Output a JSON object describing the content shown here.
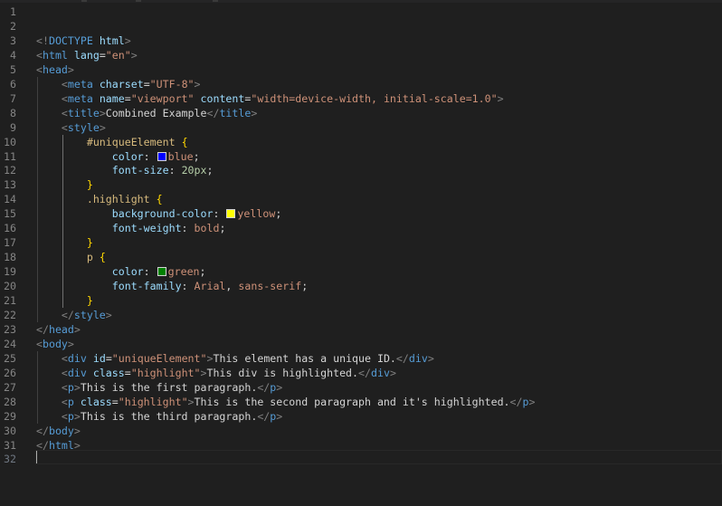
{
  "editor": {
    "lines": [
      {
        "n": "1",
        "tokens": []
      },
      {
        "n": "2",
        "tokens": []
      },
      {
        "n": "3",
        "tokens": [
          {
            "c": "br",
            "t": "<!"
          },
          {
            "c": "tag",
            "t": "DOCTYPE"
          },
          {
            "c": "txt",
            "t": " "
          },
          {
            "c": "attr",
            "t": "html"
          },
          {
            "c": "br",
            "t": ">"
          }
        ]
      },
      {
        "n": "4",
        "tokens": [
          {
            "c": "br",
            "t": "<"
          },
          {
            "c": "tag",
            "t": "html"
          },
          {
            "c": "txt",
            "t": " "
          },
          {
            "c": "attr",
            "t": "lang"
          },
          {
            "c": "txt",
            "t": "="
          },
          {
            "c": "str",
            "t": "\"en\""
          },
          {
            "c": "br",
            "t": ">"
          }
        ]
      },
      {
        "n": "5",
        "tokens": [
          {
            "c": "br",
            "t": "<"
          },
          {
            "c": "tag",
            "t": "head"
          },
          {
            "c": "br",
            "t": ">"
          }
        ]
      },
      {
        "n": "6",
        "tokens": [
          {
            "c": "txt",
            "t": "    "
          },
          {
            "c": "br",
            "t": "<"
          },
          {
            "c": "tag",
            "t": "meta"
          },
          {
            "c": "txt",
            "t": " "
          },
          {
            "c": "attr",
            "t": "charset"
          },
          {
            "c": "txt",
            "t": "="
          },
          {
            "c": "str",
            "t": "\"UTF-8\""
          },
          {
            "c": "br",
            "t": ">"
          }
        ]
      },
      {
        "n": "7",
        "tokens": [
          {
            "c": "txt",
            "t": "    "
          },
          {
            "c": "br",
            "t": "<"
          },
          {
            "c": "tag",
            "t": "meta"
          },
          {
            "c": "txt",
            "t": " "
          },
          {
            "c": "attr",
            "t": "name"
          },
          {
            "c": "txt",
            "t": "="
          },
          {
            "c": "str",
            "t": "\"viewport\""
          },
          {
            "c": "txt",
            "t": " "
          },
          {
            "c": "attr",
            "t": "content"
          },
          {
            "c": "txt",
            "t": "="
          },
          {
            "c": "str",
            "t": "\"width=device-width, initial-scale=1.0\""
          },
          {
            "c": "br",
            "t": ">"
          }
        ]
      },
      {
        "n": "8",
        "tokens": [
          {
            "c": "txt",
            "t": "    "
          },
          {
            "c": "br",
            "t": "<"
          },
          {
            "c": "tag",
            "t": "title"
          },
          {
            "c": "br",
            "t": ">"
          },
          {
            "c": "txt",
            "t": "Combined Example"
          },
          {
            "c": "br",
            "t": "</"
          },
          {
            "c": "tag",
            "t": "title"
          },
          {
            "c": "br",
            "t": ">"
          }
        ]
      },
      {
        "n": "9",
        "tokens": [
          {
            "c": "txt",
            "t": "    "
          },
          {
            "c": "br",
            "t": "<"
          },
          {
            "c": "tag",
            "t": "style"
          },
          {
            "c": "br",
            "t": ">"
          }
        ]
      },
      {
        "n": "10",
        "tokens": [
          {
            "c": "txt",
            "t": "        "
          },
          {
            "c": "sel",
            "t": "#uniqueElement"
          },
          {
            "c": "txt",
            "t": " "
          },
          {
            "c": "brace",
            "t": "{"
          }
        ]
      },
      {
        "n": "11",
        "tokens": [
          {
            "c": "txt",
            "t": "            "
          },
          {
            "c": "prop",
            "t": "color"
          },
          {
            "c": "txt",
            "t": ": "
          },
          {
            "c": "swatch",
            "t": "#0000ff"
          },
          {
            "c": "val",
            "t": "blue"
          },
          {
            "c": "txt",
            "t": ";"
          }
        ]
      },
      {
        "n": "12",
        "tokens": [
          {
            "c": "txt",
            "t": "            "
          },
          {
            "c": "prop",
            "t": "font-size"
          },
          {
            "c": "txt",
            "t": ": "
          },
          {
            "c": "num",
            "t": "20px"
          },
          {
            "c": "txt",
            "t": ";"
          }
        ]
      },
      {
        "n": "13",
        "tokens": [
          {
            "c": "txt",
            "t": "        "
          },
          {
            "c": "brace",
            "t": "}"
          }
        ]
      },
      {
        "n": "14",
        "tokens": [
          {
            "c": "txt",
            "t": "        "
          },
          {
            "c": "sel",
            "t": ".highlight"
          },
          {
            "c": "txt",
            "t": " "
          },
          {
            "c": "brace",
            "t": "{"
          }
        ]
      },
      {
        "n": "15",
        "tokens": [
          {
            "c": "txt",
            "t": "            "
          },
          {
            "c": "prop",
            "t": "background-color"
          },
          {
            "c": "txt",
            "t": ": "
          },
          {
            "c": "swatch",
            "t": "#ffff00"
          },
          {
            "c": "val",
            "t": "yellow"
          },
          {
            "c": "txt",
            "t": ";"
          }
        ]
      },
      {
        "n": "16",
        "tokens": [
          {
            "c": "txt",
            "t": "            "
          },
          {
            "c": "prop",
            "t": "font-weight"
          },
          {
            "c": "txt",
            "t": ": "
          },
          {
            "c": "val",
            "t": "bold"
          },
          {
            "c": "txt",
            "t": ";"
          }
        ]
      },
      {
        "n": "17",
        "tokens": [
          {
            "c": "txt",
            "t": "        "
          },
          {
            "c": "brace",
            "t": "}"
          }
        ]
      },
      {
        "n": "18",
        "tokens": [
          {
            "c": "txt",
            "t": "        "
          },
          {
            "c": "sel",
            "t": "p"
          },
          {
            "c": "txt",
            "t": " "
          },
          {
            "c": "brace",
            "t": "{"
          }
        ]
      },
      {
        "n": "19",
        "tokens": [
          {
            "c": "txt",
            "t": "            "
          },
          {
            "c": "prop",
            "t": "color"
          },
          {
            "c": "txt",
            "t": ": "
          },
          {
            "c": "swatch",
            "t": "#008000"
          },
          {
            "c": "val",
            "t": "green"
          },
          {
            "c": "txt",
            "t": ";"
          }
        ]
      },
      {
        "n": "20",
        "tokens": [
          {
            "c": "txt",
            "t": "            "
          },
          {
            "c": "prop",
            "t": "font-family"
          },
          {
            "c": "txt",
            "t": ": "
          },
          {
            "c": "val",
            "t": "Arial"
          },
          {
            "c": "txt",
            "t": ", "
          },
          {
            "c": "val",
            "t": "sans-serif"
          },
          {
            "c": "txt",
            "t": ";"
          }
        ]
      },
      {
        "n": "21",
        "tokens": [
          {
            "c": "txt",
            "t": "        "
          },
          {
            "c": "brace",
            "t": "}"
          }
        ]
      },
      {
        "n": "22",
        "tokens": [
          {
            "c": "txt",
            "t": "    "
          },
          {
            "c": "br",
            "t": "</"
          },
          {
            "c": "tag",
            "t": "style"
          },
          {
            "c": "br",
            "t": ">"
          }
        ]
      },
      {
        "n": "23",
        "tokens": [
          {
            "c": "br",
            "t": "</"
          },
          {
            "c": "tag",
            "t": "head"
          },
          {
            "c": "br",
            "t": ">"
          }
        ]
      },
      {
        "n": "24",
        "tokens": [
          {
            "c": "br",
            "t": "<"
          },
          {
            "c": "tag",
            "t": "body"
          },
          {
            "c": "br",
            "t": ">"
          }
        ]
      },
      {
        "n": "25",
        "tokens": [
          {
            "c": "txt",
            "t": "    "
          },
          {
            "c": "br",
            "t": "<"
          },
          {
            "c": "tag",
            "t": "div"
          },
          {
            "c": "txt",
            "t": " "
          },
          {
            "c": "attr",
            "t": "id"
          },
          {
            "c": "txt",
            "t": "="
          },
          {
            "c": "str",
            "t": "\"uniqueElement\""
          },
          {
            "c": "br",
            "t": ">"
          },
          {
            "c": "txt",
            "t": "This element has a unique ID."
          },
          {
            "c": "br",
            "t": "</"
          },
          {
            "c": "tag",
            "t": "div"
          },
          {
            "c": "br",
            "t": ">"
          }
        ]
      },
      {
        "n": "26",
        "tokens": [
          {
            "c": "txt",
            "t": "    "
          },
          {
            "c": "br",
            "t": "<"
          },
          {
            "c": "tag",
            "t": "div"
          },
          {
            "c": "txt",
            "t": " "
          },
          {
            "c": "attr",
            "t": "class"
          },
          {
            "c": "txt",
            "t": "="
          },
          {
            "c": "str",
            "t": "\"highlight\""
          },
          {
            "c": "br",
            "t": ">"
          },
          {
            "c": "txt",
            "t": "This div is highlighted."
          },
          {
            "c": "br",
            "t": "</"
          },
          {
            "c": "tag",
            "t": "div"
          },
          {
            "c": "br",
            "t": ">"
          }
        ]
      },
      {
        "n": "27",
        "tokens": [
          {
            "c": "txt",
            "t": "    "
          },
          {
            "c": "br",
            "t": "<"
          },
          {
            "c": "tag",
            "t": "p"
          },
          {
            "c": "br",
            "t": ">"
          },
          {
            "c": "txt",
            "t": "This is the first paragraph."
          },
          {
            "c": "br",
            "t": "</"
          },
          {
            "c": "tag",
            "t": "p"
          },
          {
            "c": "br",
            "t": ">"
          }
        ]
      },
      {
        "n": "28",
        "tokens": [
          {
            "c": "txt",
            "t": "    "
          },
          {
            "c": "br",
            "t": "<"
          },
          {
            "c": "tag",
            "t": "p"
          },
          {
            "c": "txt",
            "t": " "
          },
          {
            "c": "attr",
            "t": "class"
          },
          {
            "c": "txt",
            "t": "="
          },
          {
            "c": "str",
            "t": "\"highlight\""
          },
          {
            "c": "br",
            "t": ">"
          },
          {
            "c": "txt",
            "t": "This is the second paragraph and it's highlighted."
          },
          {
            "c": "br",
            "t": "</"
          },
          {
            "c": "tag",
            "t": "p"
          },
          {
            "c": "br",
            "t": ">"
          }
        ]
      },
      {
        "n": "29",
        "tokens": [
          {
            "c": "txt",
            "t": "    "
          },
          {
            "c": "br",
            "t": "<"
          },
          {
            "c": "tag",
            "t": "p"
          },
          {
            "c": "br",
            "t": ">"
          },
          {
            "c": "txt",
            "t": "This is the third paragraph."
          },
          {
            "c": "br",
            "t": "</"
          },
          {
            "c": "tag",
            "t": "p"
          },
          {
            "c": "br",
            "t": ">"
          }
        ]
      },
      {
        "n": "30",
        "tokens": [
          {
            "c": "br",
            "t": "</"
          },
          {
            "c": "tag",
            "t": "body"
          },
          {
            "c": "br",
            "t": ">"
          }
        ]
      },
      {
        "n": "31",
        "tokens": [
          {
            "c": "br",
            "t": "</"
          },
          {
            "c": "tag",
            "t": "html"
          },
          {
            "c": "br",
            "t": ">"
          }
        ]
      },
      {
        "n": "32",
        "tokens": []
      }
    ],
    "active_line": "32"
  }
}
